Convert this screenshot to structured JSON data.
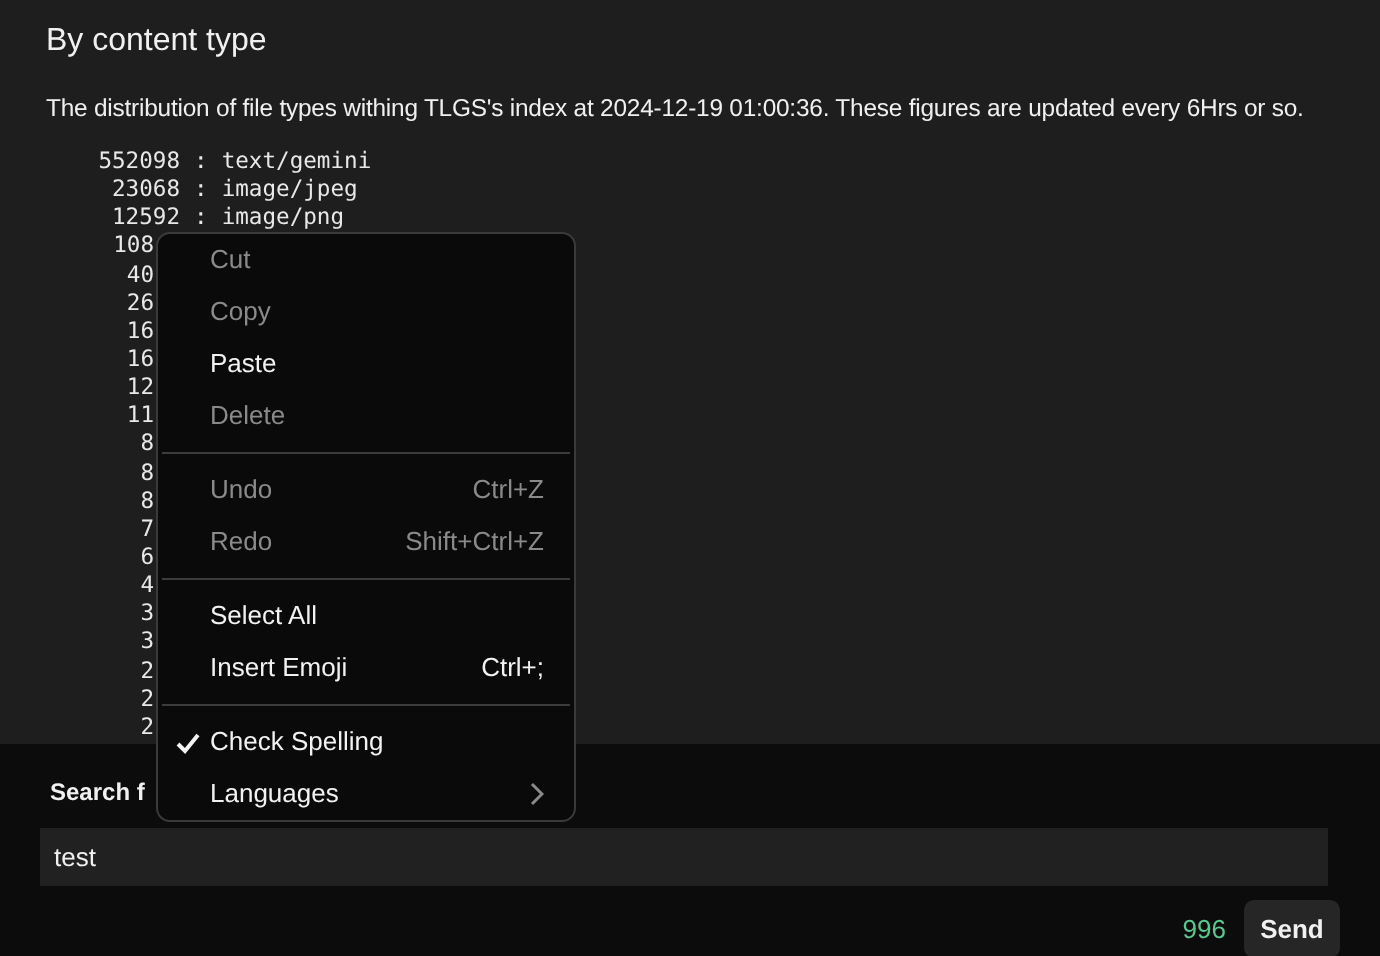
{
  "heading": "By content type",
  "description": "The distribution of file types withing TLGS's index at 2024-12-19 01:00:36. These figures are updated every 6Hrs or so.",
  "listing": [
    {
      "kind": "full",
      "count": "552098",
      "separator": ":",
      "type": "text/gemini"
    },
    {
      "kind": "full",
      "count": "23068",
      "separator": ":",
      "type": "image/jpeg"
    },
    {
      "kind": "full",
      "count": "12592",
      "separator": ":",
      "type": "image/png"
    },
    {
      "kind": "cut",
      "count": "108"
    },
    {
      "kind": "cut",
      "count": "40"
    },
    {
      "kind": "cut",
      "count": "26"
    },
    {
      "kind": "cut",
      "count": "16"
    },
    {
      "kind": "cut",
      "count": "16"
    },
    {
      "kind": "cut",
      "count": "12"
    },
    {
      "kind": "cut",
      "count": "11"
    },
    {
      "kind": "cut",
      "count": "8"
    },
    {
      "kind": "cut",
      "count": "8"
    },
    {
      "kind": "cut",
      "count": "8"
    },
    {
      "kind": "cut",
      "count": "7"
    },
    {
      "kind": "cut",
      "count": "6"
    },
    {
      "kind": "cut",
      "count": "4"
    },
    {
      "kind": "cut",
      "count": "3"
    },
    {
      "kind": "cut",
      "count": "3"
    },
    {
      "kind": "cut",
      "count": "2"
    },
    {
      "kind": "cut",
      "count": "2"
    },
    {
      "kind": "cut",
      "count": "2"
    }
  ],
  "context_menu": [
    {
      "kind": "item",
      "label": "Cut",
      "disabled": true
    },
    {
      "kind": "item",
      "label": "Copy",
      "disabled": true
    },
    {
      "kind": "item",
      "label": "Paste",
      "disabled": false
    },
    {
      "kind": "item",
      "label": "Delete",
      "disabled": true
    },
    {
      "kind": "separator"
    },
    {
      "kind": "item",
      "label": "Undo",
      "shortcut": "Ctrl+Z",
      "disabled": true
    },
    {
      "kind": "item",
      "label": "Redo",
      "shortcut": "Shift+Ctrl+Z",
      "disabled": true
    },
    {
      "kind": "separator"
    },
    {
      "kind": "item",
      "label": "Select All",
      "disabled": false
    },
    {
      "kind": "item",
      "label": "Insert Emoji",
      "shortcut": "Ctrl+;",
      "disabled": false
    },
    {
      "kind": "separator"
    },
    {
      "kind": "check",
      "label": "Check Spelling",
      "checked": true,
      "disabled": false
    },
    {
      "kind": "submenu",
      "label": "Languages",
      "disabled": false
    }
  ],
  "search": {
    "label": "Search f",
    "value": "test",
    "remaining": "996",
    "button": "Send"
  }
}
